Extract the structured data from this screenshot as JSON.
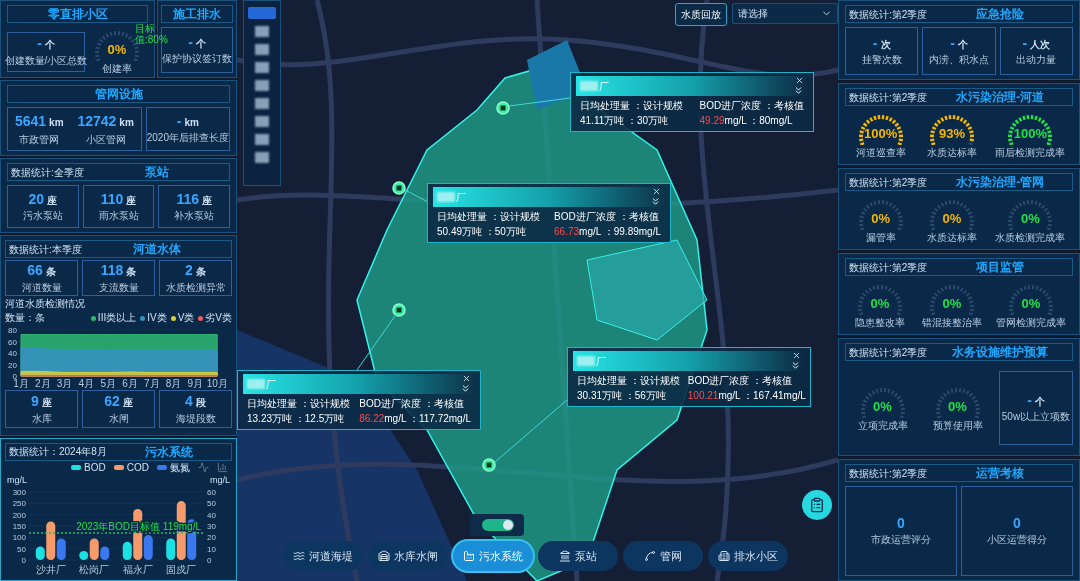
{
  "left": {
    "zero_discharge": {
      "title": "零直排小区",
      "stat": {
        "value": "-",
        "unit": "个",
        "label": "创建数量/小区总数"
      },
      "gauge": {
        "value": "0%",
        "label": "创建率",
        "color": "#f5b800",
        "target": "目标值:80%"
      }
    },
    "construction": {
      "title": "施工排水",
      "stat": {
        "value": "-",
        "unit": "个",
        "label": "保护协议签订数"
      }
    },
    "pipe": {
      "title": "管网设施",
      "stats": [
        {
          "value": "5641",
          "unit": "km",
          "label": "市政管网"
        },
        {
          "value": "12742",
          "unit": "km",
          "label": "小区管网"
        },
        {
          "value": "-",
          "unit": "km",
          "label": "2020年后排查长度"
        }
      ]
    },
    "pump": {
      "title": "泵站",
      "tag": "数据统计:全季度",
      "stats": [
        {
          "value": "20",
          "unit": "座",
          "label": "污水泵站"
        },
        {
          "value": "110",
          "unit": "座",
          "label": "雨水泵站"
        },
        {
          "value": "116",
          "unit": "座",
          "label": "补水泵站"
        }
      ]
    },
    "river": {
      "title": "河道水体",
      "tag": "数据统计:本季度",
      "stats": [
        {
          "value": "66",
          "unit": "条",
          "label": "河道数量"
        },
        {
          "value": "118",
          "unit": "条",
          "label": "支流数量"
        },
        {
          "value": "2",
          "unit": "条",
          "label": "水质检测异常"
        }
      ],
      "chart_title": "河道水质检测情况",
      "chart_data": {
        "type": "area",
        "ylabel": "数量：条",
        "grid": true,
        "categories": [
          "1月",
          "2月",
          "3月",
          "4月",
          "5月",
          "6月",
          "7月",
          "8月",
          "9月",
          "10月"
        ],
        "yticks": [
          0,
          20,
          40,
          60,
          80
        ],
        "ylim": [
          0,
          80
        ],
        "series": [
          {
            "name": "III类以上",
            "color": "#2fb873",
            "values": [
              72,
              72,
              72,
              72,
              72,
              72,
              72,
              72,
              72,
              72
            ]
          },
          {
            "name": "IV类",
            "color": "#3691c4",
            "values": [
              50,
              47,
              46,
              46,
              45,
              46,
              46,
              46,
              46,
              46
            ]
          },
          {
            "name": "V类",
            "color": "#d9cf3a",
            "values": [
              8,
              8,
              6,
              6,
              6,
              7,
              6,
              6,
              6,
              6
            ]
          },
          {
            "name": "劣V类",
            "color": "#f05a5a",
            "values": [
              1,
              1,
              1,
              1,
              1,
              1,
              1,
              1,
              1,
              1
            ]
          }
        ]
      },
      "stats2": [
        {
          "value": "9",
          "unit": "座",
          "label": "水库"
        },
        {
          "value": "62",
          "unit": "座",
          "label": "水闸"
        },
        {
          "value": "4",
          "unit": "段",
          "label": "海堤段数"
        }
      ]
    },
    "sewage": {
      "title": "污水系统",
      "tag": "数据统计：2024年8月",
      "chart_data": {
        "type": "bar",
        "ylabel": "mg/L",
        "y2label": "mg/L",
        "grid": true,
        "categories": [
          "沙井厂",
          "松岗厂",
          "福永厂",
          "固戍厂"
        ],
        "yticks": [
          0,
          50,
          100,
          150,
          200,
          250,
          300
        ],
        "ylim": [
          0,
          300
        ],
        "y2ticks": [
          0,
          10,
          20,
          30,
          40,
          50,
          60
        ],
        "y2lim": [
          0,
          60
        ],
        "series": [
          {
            "name": "BOD",
            "color": "#1de0e0",
            "values": [
              60,
              40,
              80,
              95
            ]
          },
          {
            "name": "COD",
            "color": "#f59a6a",
            "values": [
              170,
              95,
              225,
              260
            ]
          },
          {
            "name": "氨氮",
            "color": "#3a78f0",
            "axis": "y2",
            "values": [
              19,
              12,
              22,
              36
            ]
          }
        ],
        "ref_lines": [
          {
            "axis": "y",
            "value": 119,
            "label": "2023年BOD目标值 119mg/L",
            "color": "#22c060"
          }
        ]
      }
    }
  },
  "map": {
    "district_list": [
      {
        "selected": true
      },
      {
        "selected": false
      },
      {
        "selected": false
      },
      {
        "selected": false
      },
      {
        "selected": false
      },
      {
        "selected": false
      },
      {
        "selected": false
      },
      {
        "selected": false
      },
      {
        "selected": false
      }
    ],
    "replay_button": "水质回放",
    "select": {
      "placeholder": "请选择"
    },
    "popups": [
      {
        "name": "厂",
        "labels": "日均处理量 ：设计规模",
        "capacity": "41.11万吨 ：30万吨",
        "bod_label": "BOD进厂浓度 ：考核值",
        "bod_value": "49.29",
        "bod_rest": "mg/L ：80mg/L"
      },
      {
        "name": "厂",
        "labels": "日均处理量 ：设计规模",
        "capacity": "50.49万吨 ：50万吨",
        "bod_label": "BOD进厂浓度 ：考核值",
        "bod_value": "66.73",
        "bod_rest": "mg/L ：99.89mg/L"
      },
      {
        "name": "厂",
        "labels": "日均处理量 ：设计规模",
        "capacity": "13.23万吨 ：12.5万吨",
        "bod_label": "BOD进厂浓度 ：考核值",
        "bod_value": "86.22",
        "bod_rest": "mg/L ：117.72mg/L"
      },
      {
        "name": "厂",
        "labels": "日均处理量 ：设计规模",
        "capacity": "30.31万吨 ：56万吨",
        "bod_label": "BOD进厂浓度 ：考核值",
        "bod_value": "100.21",
        "bod_rest": "mg/L ：167.41mg/L"
      }
    ],
    "toggle": {
      "on": true
    },
    "nav": [
      {
        "label": "河道海堤",
        "selected": false
      },
      {
        "label": "水库水闸",
        "selected": false
      },
      {
        "label": "污水系统",
        "selected": true
      },
      {
        "label": "泵站",
        "selected": false
      },
      {
        "label": "管网",
        "selected": false
      },
      {
        "label": "排水小区",
        "selected": false
      }
    ]
  },
  "right": {
    "emergency": {
      "title": "应急抢险",
      "tag": "数据统计:第2季度",
      "stats": [
        {
          "value": "-",
          "unit": "次",
          "label": "挂警次数"
        },
        {
          "value": "-",
          "unit": "个",
          "label": "内涝、积水点"
        },
        {
          "value": "-",
          "unit": "人次",
          "label": "出动力量"
        }
      ]
    },
    "river_gov": {
      "title": "水污染治理-河道",
      "tag": "数据统计:第2季度",
      "gauges": [
        {
          "value": "100%",
          "label": "河道巡查率",
          "color": "#f5b800"
        },
        {
          "value": "93%",
          "label": "水质达标率",
          "color": "#f5b800"
        },
        {
          "value": "100%",
          "label": "雨后检测完成率",
          "color": "#22e04a"
        }
      ]
    },
    "pipe_gov": {
      "title": "水污染治理-管网",
      "tag": "数据统计:第2季度",
      "gauges": [
        {
          "value": "0%",
          "label": "漏管率",
          "color": "#f5b800"
        },
        {
          "value": "0%",
          "label": "水质达标率",
          "color": "#f5b800"
        },
        {
          "value": "0%",
          "label": "水质检测完成率",
          "color": "#22e04a"
        }
      ]
    },
    "project": {
      "title": "项目监管",
      "tag": "数据统计:第2季度",
      "gauges": [
        {
          "value": "0%",
          "label": "隐患整改率",
          "color": "#22e04a"
        },
        {
          "value": "0%",
          "label": "错混接整治率",
          "color": "#22e04a"
        },
        {
          "value": "0%",
          "label": "管网检测完成率",
          "color": "#22e04a"
        }
      ]
    },
    "budget": {
      "title": "水务设施维护预算",
      "tag": "数据统计:第2季度",
      "gauges": [
        {
          "value": "0%",
          "label": "立项完成率",
          "color": "#22e04a"
        },
        {
          "value": "0%",
          "label": "预算使用率",
          "color": "#22e04a"
        }
      ],
      "stat": {
        "value": "-",
        "unit": "个",
        "label": "50w以上立项数"
      }
    },
    "ops": {
      "title": "运营考核",
      "tag": "数据统计:第2季度",
      "stats": [
        {
          "value": "0",
          "label": "市政运营评分"
        },
        {
          "value": "0",
          "label": "小区运营得分"
        }
      ]
    }
  }
}
